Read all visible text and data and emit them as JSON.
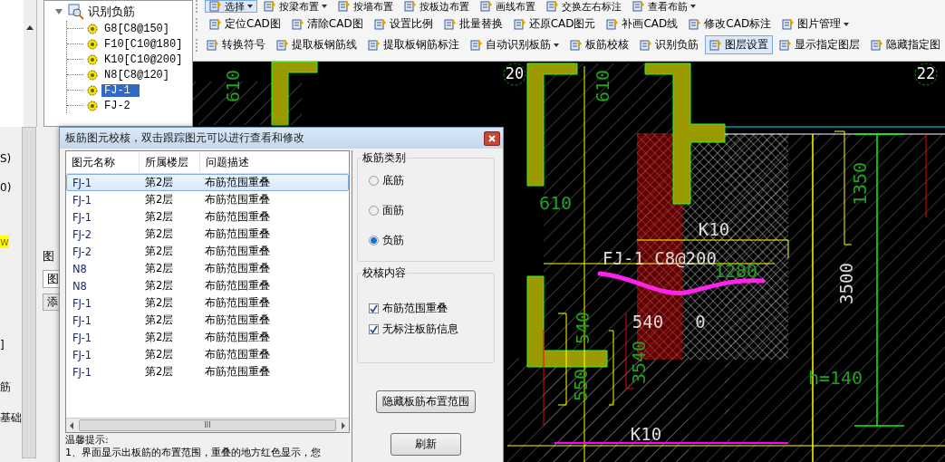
{
  "toolbar_rows": [
    [
      {
        "label": "选择",
        "dropdown": true,
        "selected": true
      },
      {
        "label": "按梁布置",
        "dropdown": true,
        "selected": false
      },
      {
        "label": "按墙布置",
        "dropdown": false,
        "selected": false
      },
      {
        "label": "按板边布置",
        "dropdown": false,
        "selected": false
      },
      {
        "label": "画线布置",
        "dropdown": false,
        "selected": false
      },
      {
        "label": "交换左右标注",
        "dropdown": false,
        "selected": false
      },
      {
        "label": "查看布筋",
        "dropdown": true,
        "selected": false
      }
    ],
    [
      {
        "label": "定位CAD图",
        "dropdown": false,
        "selected": false
      },
      {
        "label": "清除CAD图",
        "dropdown": false,
        "selected": false
      },
      {
        "label": "设置比例",
        "dropdown": false,
        "selected": false
      },
      {
        "label": "批量替换",
        "dropdown": false,
        "selected": false
      },
      {
        "label": "还原CAD图元",
        "dropdown": false,
        "selected": false
      },
      {
        "label": "补画CAD线",
        "dropdown": false,
        "selected": false
      },
      {
        "label": "修改CAD标注",
        "dropdown": false,
        "selected": false
      },
      {
        "label": "图片管理",
        "dropdown": true,
        "selected": false
      }
    ],
    [
      {
        "label": "转换符号",
        "dropdown": false,
        "selected": false
      },
      {
        "label": "提取板钢筋线",
        "dropdown": false,
        "selected": false
      },
      {
        "label": "提取板钢筋标注",
        "dropdown": false,
        "selected": false
      },
      {
        "label": "自动识别板筋",
        "dropdown": true,
        "selected": false
      },
      {
        "label": "板筋校核",
        "dropdown": false,
        "selected": false
      },
      {
        "label": "识别负筋",
        "dropdown": false,
        "selected": false
      },
      {
        "label": "图层设置",
        "dropdown": false,
        "selected": true
      },
      {
        "label": "显示指定图层",
        "dropdown": false,
        "selected": false
      },
      {
        "label": "隐藏指定图",
        "dropdown": false,
        "selected": false
      }
    ]
  ],
  "tree": {
    "label": "识别负筋",
    "expanded": true,
    "children": [
      {
        "label": "G8[C8@150]",
        "selected": false
      },
      {
        "label": "F10[C10@180]",
        "selected": false
      },
      {
        "label": "K10[C10@200]",
        "selected": false
      },
      {
        "label": "N8[C8@120]",
        "selected": false
      },
      {
        "label": "FJ-1",
        "selected": true
      },
      {
        "label": "FJ-2",
        "selected": false
      }
    ]
  },
  "left_edge_texts": [
    "S)",
    "0)",
    "w",
    "]",
    "筋",
    "基础"
  ],
  "side_panel": {
    "title": "图",
    "tab": "图",
    "button": "添"
  },
  "canvas": {
    "labels": [
      {
        "text": "20",
        "kind": "axis"
      },
      {
        "text": "22",
        "kind": "axis"
      },
      {
        "text": "610",
        "kind": "dim"
      },
      {
        "text": "610",
        "kind": "dim"
      },
      {
        "text": "610",
        "kind": "dim"
      },
      {
        "text": "K10",
        "kind": "tag"
      },
      {
        "text": "FJ-1 C8@200",
        "kind": "tag"
      },
      {
        "text": "1280",
        "kind": "dim"
      },
      {
        "text": "540",
        "kind": "tag"
      },
      {
        "text": "0",
        "kind": "tag"
      },
      {
        "text": "3500",
        "kind": "tag"
      },
      {
        "text": "1350",
        "kind": "dim"
      },
      {
        "text": "h=140",
        "kind": "dim"
      },
      {
        "text": "540",
        "kind": "dim"
      },
      {
        "text": "550",
        "kind": "dim"
      },
      {
        "text": "3540",
        "kind": "dim"
      },
      {
        "text": "K10",
        "kind": "tag"
      }
    ]
  },
  "dialog": {
    "title": "板筋图元校核，双击跟踪图元可以进行查看和修改",
    "columns": [
      "图元名称",
      "所属楼层",
      "问题描述"
    ],
    "rows": [
      {
        "cells": [
          "FJ-1",
          "第2层",
          "布筋范围重叠"
        ],
        "selected": true
      },
      {
        "cells": [
          "FJ-1",
          "第2层",
          "布筋范围重叠"
        ],
        "selected": false
      },
      {
        "cells": [
          "FJ-1",
          "第2层",
          "布筋范围重叠"
        ],
        "selected": false
      },
      {
        "cells": [
          "FJ-2",
          "第2层",
          "布筋范围重叠"
        ],
        "selected": false
      },
      {
        "cells": [
          "FJ-2",
          "第2层",
          "布筋范围重叠"
        ],
        "selected": false
      },
      {
        "cells": [
          "N8",
          "第2层",
          "布筋范围重叠"
        ],
        "selected": false
      },
      {
        "cells": [
          "N8",
          "第2层",
          "布筋范围重叠"
        ],
        "selected": false
      },
      {
        "cells": [
          "FJ-1",
          "第2层",
          "布筋范围重叠"
        ],
        "selected": false
      },
      {
        "cells": [
          "FJ-1",
          "第2层",
          "布筋范围重叠"
        ],
        "selected": false
      },
      {
        "cells": [
          "FJ-1",
          "第2层",
          "布筋范围重叠"
        ],
        "selected": false
      },
      {
        "cells": [
          "FJ-1",
          "第2层",
          "布筋范围重叠"
        ],
        "selected": false
      },
      {
        "cells": [
          "FJ-1",
          "第2层",
          "布筋范围重叠"
        ],
        "selected": false
      }
    ],
    "scrollbar_thumb": "III",
    "tip_title": "温馨提示:",
    "tip_line": "1、界面显示出板筋的布置范围，重叠的地方红色显示，您",
    "type_group": {
      "title": "板筋类别",
      "options": [
        {
          "label": "底筋",
          "selected": false
        },
        {
          "label": "面筋",
          "selected": false
        },
        {
          "label": "负筋",
          "selected": true
        }
      ]
    },
    "check_group": {
      "title": "校核内容",
      "options": [
        {
          "label": "布筋范围重叠",
          "checked": true
        },
        {
          "label": "无标注板筋信息",
          "checked": true
        }
      ]
    },
    "buttons": [
      "隐藏板筋布置范围",
      "刷新"
    ]
  }
}
